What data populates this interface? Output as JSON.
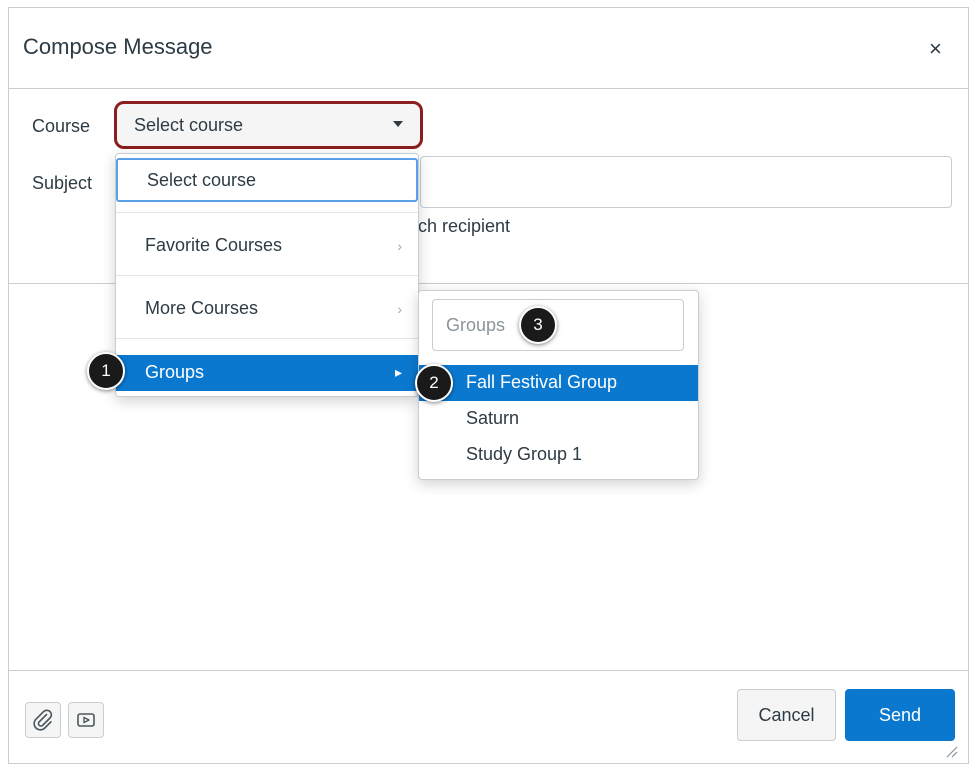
{
  "dialog": {
    "title": "Compose Message",
    "close_glyph": "×"
  },
  "form": {
    "course_label": "Course",
    "subject_label": "Subject",
    "course_selected": "Select course",
    "partial_text": "ch recipient"
  },
  "course_menu": {
    "items": [
      {
        "label": "Select course",
        "has_submenu": false,
        "state": "focused"
      },
      {
        "label": "Favorite Courses",
        "has_submenu": true
      },
      {
        "label": "More Courses",
        "has_submenu": true
      },
      {
        "label": "Groups",
        "has_submenu": true,
        "state": "active"
      }
    ]
  },
  "groups_submenu": {
    "search_placeholder": "Groups",
    "items": [
      {
        "label": "Fall Festival Group",
        "state": "active"
      },
      {
        "label": "Saturn"
      },
      {
        "label": "Study Group 1"
      }
    ]
  },
  "callouts": [
    "1",
    "2",
    "3"
  ],
  "footer": {
    "attach_icon": "paperclip-icon",
    "media_icon": "media-icon",
    "cancel_label": "Cancel",
    "send_label": "Send"
  },
  "colors": {
    "accent": "#0b78d0",
    "highlight_border": "#8b1e1e",
    "focus_ring": "#5aa0e6",
    "text": "#2d3b45"
  }
}
